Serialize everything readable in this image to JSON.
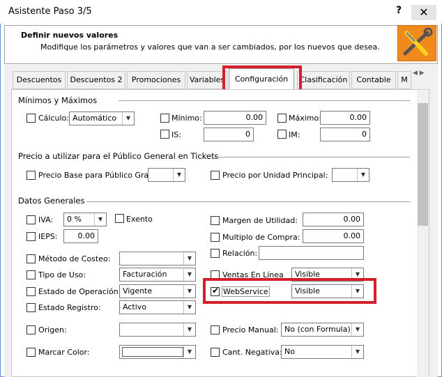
{
  "window": {
    "title": "Asistente Paso 3/5",
    "help": "?",
    "close": "✕"
  },
  "header": {
    "title": "Definir nuevos valores",
    "subtitle": "Modifique los parámetros y valores que van a ser cambiados, por los nuevos que desea."
  },
  "tabs": [
    "Descuentos",
    "Descuentos 2",
    "Promociones",
    "Variables",
    "Configuración",
    "Clasificación",
    "Contable",
    "M"
  ],
  "sections": {
    "minmax": "Mínimos y Máximos",
    "precio": "Precio a utilizar para el Público General en Tickets",
    "datos": "Datos Generales"
  },
  "minmax": {
    "calculo_label": "Cálculo:",
    "calculo_value": "Automático",
    "minimo_label": "Mínimo:",
    "minimo_value": "0.00",
    "maximo_label": "Máximo:",
    "maximo_value": "0.00",
    "is_label": "IS:",
    "is_value": "0",
    "im_label": "IM:",
    "im_value": "0"
  },
  "precio": {
    "base_label": "Precio Base para Público Gral:",
    "unidad_label": "Precio por Unidad Principal:"
  },
  "datos": {
    "iva_label": "IVA:",
    "iva_value": "0 %",
    "exento_label": "Exento",
    "ieps_label": "IEPS:",
    "ieps_value": "0.00",
    "margen_label": "Margen de Utilidad:",
    "margen_value": "0.00",
    "multiplo_label": "Multiplo de Compra:",
    "multiplo_value": "0.00",
    "relacion_label": "Relación:",
    "costeo_label": "Método de Costeo:",
    "uso_label": "Tipo de Uso:",
    "uso_value": "Facturación",
    "ventas_label": "Ventas En Línea",
    "ventas_value": "Visible",
    "estado_label": "Estado de Operación:",
    "estado_value": "Vigente",
    "webservice_label": "WebService",
    "webservice_value": "Visible",
    "registro_label": "Estado Registro:",
    "registro_value": "Activo",
    "origen_label": "Origen:",
    "precio_manual_label": "Precio Manual:",
    "precio_manual_value": "No (con Formula)",
    "color_label": "Marcar Color:",
    "negativa_label": "Cant. Negativa:",
    "negativa_value": "No"
  }
}
